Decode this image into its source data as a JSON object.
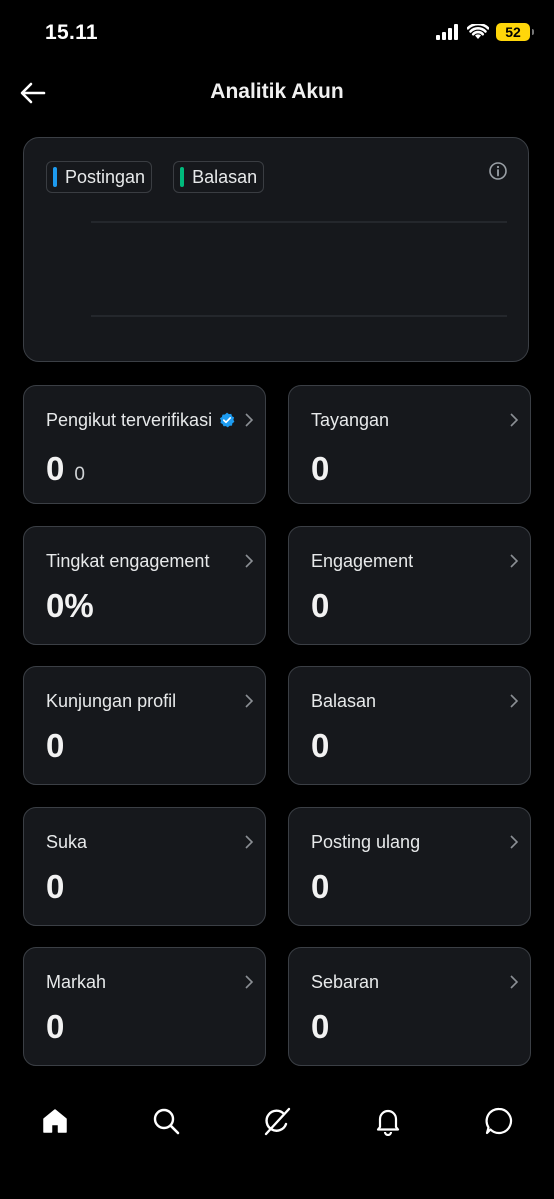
{
  "status_bar": {
    "time": "15.11",
    "battery": "52"
  },
  "header": {
    "title": "Analitik Akun"
  },
  "chart": {
    "legend": [
      {
        "label": "Postingan",
        "color": "#1d9bf0"
      },
      {
        "label": "Balasan",
        "color": "#00ba7c"
      }
    ]
  },
  "cards": [
    {
      "label": "Pengikut terverifikasi",
      "value": "0",
      "subvalue": "0",
      "verified": true
    },
    {
      "label": "Tayangan",
      "value": "0"
    },
    {
      "label": "Tingkat engagement",
      "value": "0%"
    },
    {
      "label": "Engagement",
      "value": "0"
    },
    {
      "label": "Kunjungan profil",
      "value": "0"
    },
    {
      "label": "Balasan",
      "value": "0"
    },
    {
      "label": "Suka",
      "value": "0"
    },
    {
      "label": "Posting ulang",
      "value": "0"
    },
    {
      "label": "Markah",
      "value": "0"
    },
    {
      "label": "Sebaran",
      "value": "0"
    }
  ],
  "tabs": [
    {
      "icon": "home-icon",
      "active": true
    },
    {
      "icon": "search-icon"
    },
    {
      "icon": "grok-icon"
    },
    {
      "icon": "notifications-icon"
    },
    {
      "icon": "messages-icon"
    }
  ],
  "colors": {
    "accent": "#1d9bf0",
    "replies": "#00ba7c",
    "card_bg": "#16181c",
    "border": "#3b3f45"
  }
}
